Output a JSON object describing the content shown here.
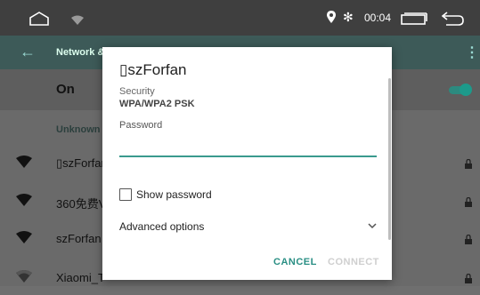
{
  "status_bar": {
    "time": "00:04",
    "icons": [
      "home-icon",
      "wifi-icon",
      "location-icon",
      "bluetooth-icon",
      "recent-apps-icon",
      "back-icon"
    ]
  },
  "app_bar": {
    "title": "Network &",
    "back_icon": "back-arrow-icon",
    "menu_icon": "more-vert-icon"
  },
  "wifi_toggle": {
    "label": "On",
    "state": "on",
    "color": "#1d9a8b"
  },
  "section": {
    "label": "Unknown"
  },
  "networks": [
    {
      "name": "▯szForfar",
      "locked": true
    },
    {
      "name": "360免费V",
      "locked": true
    },
    {
      "name": "szForfan",
      "locked": true
    },
    {
      "name": "Xiaomi_T",
      "locked": true
    }
  ],
  "dialog": {
    "title": "▯szForfan",
    "security_label": "Security",
    "security_value": "WPA/WPA2 PSK",
    "password_label": "Password",
    "password_value": "",
    "show_password_label": "Show password",
    "show_password_checked": false,
    "advanced_label": "Advanced options",
    "cancel_label": "CANCEL",
    "connect_label": "CONNECT",
    "accent_color": "#2a8f84"
  }
}
